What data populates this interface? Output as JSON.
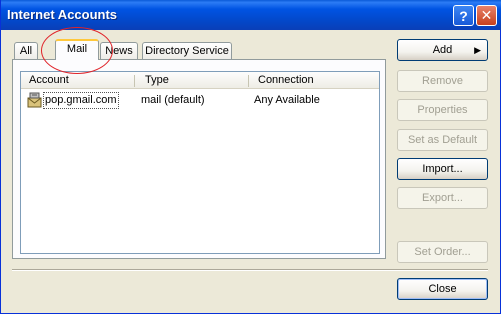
{
  "window": {
    "title": "Internet Accounts"
  },
  "titlebar_buttons": {
    "help": "?",
    "close": "✕"
  },
  "tabs": [
    {
      "label": "All"
    },
    {
      "label": "Mail"
    },
    {
      "label": "News"
    },
    {
      "label": "Directory Service"
    }
  ],
  "columns": [
    "Account",
    "Type",
    "Connection"
  ],
  "accounts": [
    {
      "account": "pop.gmail.com",
      "type": "mail (default)",
      "connection": "Any Available"
    }
  ],
  "buttons": {
    "add": "Add",
    "add_arrow": "▶",
    "remove": "Remove",
    "properties": "Properties",
    "set_default": "Set as Default",
    "import": "Import...",
    "export": "Export...",
    "set_order": "Set Order...",
    "close": "Close"
  },
  "colors": {
    "title_bar": "#0054e3",
    "window_bg": "#ece9d8",
    "highlight_circle": "#e0242a",
    "selected_tab_accent": "#ffc83c"
  },
  "icons": {
    "account": "mail-account-icon"
  }
}
